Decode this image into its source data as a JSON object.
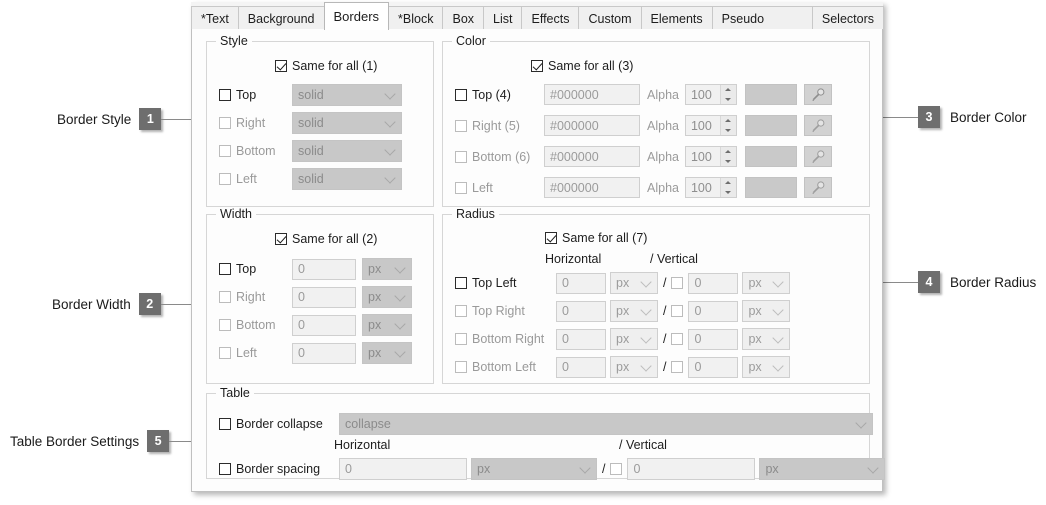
{
  "window": {
    "tabs": [
      {
        "label": "*Text",
        "active": false
      },
      {
        "label": "Background",
        "active": false
      },
      {
        "label": "Borders",
        "active": true
      },
      {
        "label": "*Block",
        "active": false
      },
      {
        "label": "Box",
        "active": false
      },
      {
        "label": "List",
        "active": false
      },
      {
        "label": "Effects",
        "active": false
      },
      {
        "label": "Custom",
        "active": false
      },
      {
        "label": "Elements",
        "active": false
      },
      {
        "label": "Pseudo Class/Element",
        "active": false
      },
      {
        "label": "Selectors",
        "active": false
      }
    ]
  },
  "callouts": [
    {
      "number": "1",
      "caption": "Border Style",
      "side": "left"
    },
    {
      "number": "2",
      "caption": "Border Width",
      "side": "left"
    },
    {
      "number": "5",
      "caption": "Table Border Settings",
      "side": "left"
    },
    {
      "number": "3",
      "caption": "Border Color",
      "side": "right"
    },
    {
      "number": "4",
      "caption": "Border Radius",
      "side": "right"
    }
  ],
  "style_group": {
    "title": "Style",
    "same_for_all": "Same for all (1)",
    "same_for_all_checked": true,
    "rows": [
      {
        "label": "Top",
        "checked": false,
        "enabled": true,
        "value": "solid"
      },
      {
        "label": "Right",
        "checked": false,
        "enabled": false,
        "value": "solid"
      },
      {
        "label": "Bottom",
        "checked": false,
        "enabled": false,
        "value": "solid"
      },
      {
        "label": "Left",
        "checked": false,
        "enabled": false,
        "value": "solid"
      }
    ]
  },
  "color_group": {
    "title": "Color",
    "same_for_all": "Same for all (3)",
    "same_for_all_checked": true,
    "alpha_label": "Alpha",
    "rows": [
      {
        "label": "Top (4)",
        "checked": false,
        "enabled": true,
        "hex": "#000000",
        "alpha": "100",
        "swatch": "#c9c9c9"
      },
      {
        "label": "Right (5)",
        "checked": false,
        "enabled": false,
        "hex": "#000000",
        "alpha": "100",
        "swatch": "#c9c9c9"
      },
      {
        "label": "Bottom (6)",
        "checked": false,
        "enabled": false,
        "hex": "#000000",
        "alpha": "100",
        "swatch": "#c9c9c9"
      },
      {
        "label": "Left",
        "checked": false,
        "enabled": false,
        "hex": "#000000",
        "alpha": "100",
        "swatch": "#c9c9c9"
      }
    ]
  },
  "width_group": {
    "title": "Width",
    "same_for_all": "Same for all (2)",
    "same_for_all_checked": true,
    "rows": [
      {
        "label": "Top",
        "checked": false,
        "enabled": true,
        "value": "0",
        "unit": "px"
      },
      {
        "label": "Right",
        "checked": false,
        "enabled": false,
        "value": "0",
        "unit": "px"
      },
      {
        "label": "Bottom",
        "checked": false,
        "enabled": false,
        "value": "0",
        "unit": "px"
      },
      {
        "label": "Left",
        "checked": false,
        "enabled": false,
        "value": "0",
        "unit": "px"
      }
    ]
  },
  "radius_group": {
    "title": "Radius",
    "same_for_all": "Same for all (7)",
    "same_for_all_checked": true,
    "horizontal_header": "Horizontal",
    "vertical_header": "/ Vertical",
    "separator": "/",
    "rows": [
      {
        "label": "Top Left",
        "checked": false,
        "enabled": true,
        "h_value": "0",
        "h_unit": "px",
        "v_checked": false,
        "v_value": "0",
        "v_unit": "px"
      },
      {
        "label": "Top Right",
        "checked": false,
        "enabled": false,
        "h_value": "0",
        "h_unit": "px",
        "v_checked": false,
        "v_value": "0",
        "v_unit": "px"
      },
      {
        "label": "Bottom Right",
        "checked": false,
        "enabled": false,
        "h_value": "0",
        "h_unit": "px",
        "v_checked": false,
        "v_value": "0",
        "v_unit": "px"
      },
      {
        "label": "Bottom Left",
        "checked": false,
        "enabled": false,
        "h_value": "0",
        "h_unit": "px",
        "v_checked": false,
        "v_value": "0",
        "v_unit": "px"
      }
    ]
  },
  "table_group": {
    "title": "Table",
    "collapse": {
      "label": "Border collapse",
      "checked": false,
      "value": "collapse"
    },
    "horizontal_header": "Horizontal",
    "vertical_header": "/ Vertical",
    "separator": "/",
    "spacing": {
      "label": "Border spacing",
      "checked": false,
      "h_value": "0",
      "h_unit": "px",
      "v_checked": false,
      "v_value": "0",
      "v_unit": "px"
    }
  }
}
